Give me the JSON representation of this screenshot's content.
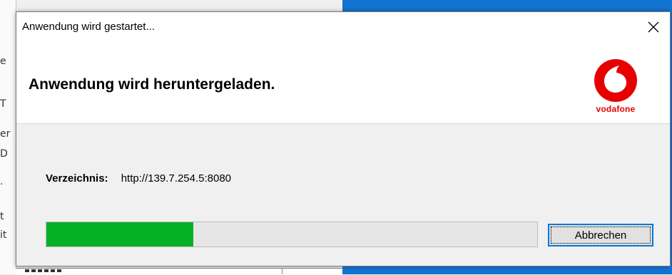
{
  "dialog": {
    "title": "Anwendung wird gestartet...",
    "header": "Anwendung wird heruntergeladen.",
    "logo_text": "vodafone",
    "directory_label": "Verzeichnis:",
    "directory_value": "http://139.7.254.5:8080",
    "progress_fraction": 0.3,
    "cancel_label": "Abbrechen"
  },
  "background": {
    "fragments": [
      "e",
      "T",
      "er",
      "D",
      ".",
      "t",
      "it"
    ]
  },
  "colors": {
    "progress_fill": "#06b025",
    "desktop_blue": "#1273d3",
    "brand_red": "#e60000",
    "focus_border": "#0078d7"
  }
}
